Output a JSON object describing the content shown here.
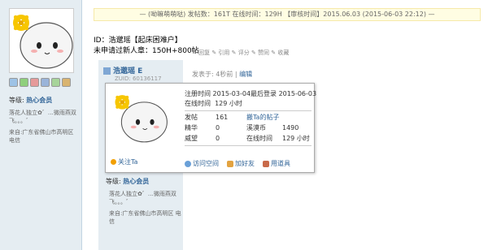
{
  "sidebar": {
    "level_prefix": "等级:",
    "level_value": "热心会员",
    "signature": "落花人独立✿゛…微雨燕双飞。。。゛",
    "location": "来自:广东省佛山市高明区 电信"
  },
  "topbar": {
    "text": "— (呦嘛萌萌哒) 发帖数：161T   在线时间：129H   【审核时间】2015.06.03 (2015-06-03 22:12) —"
  },
  "post_header": {
    "id_line": "ID：浩邈瑶【起床困难户】",
    "medal_line": "未申请过新人章：150H+800帖"
  },
  "post": {
    "username": "浩邈瑶 E",
    "uid": "ZUID: 60136117",
    "published": "发表于: 4秒前",
    "edit_link": "编辑",
    "top_actions": "✎ 回复    ✎ 引用    ✎ 评分    ✎ 赞同    ✎ 收藏"
  },
  "card": {
    "register_label": "注册时间",
    "register_value": "2015-03-04",
    "lastlogin_label": "最后登录",
    "lastlogin_value": "2015-06-03",
    "online_label": "在线时间",
    "online_value": "129 小时",
    "posts_label": "发帖",
    "posts_value": "161",
    "posts_link": "搬Ta的帖子",
    "digest_label": "精华",
    "digest_value": "0",
    "coin_label": "溪漠币",
    "coin_value": "1490",
    "prestige_label": "威望",
    "prestige_value": "0",
    "online2_label": "在线时间",
    "online2_value": "129 小时",
    "follow_label": "关注Ta",
    "visit_label": "访问空间",
    "addfriend_label": "加好友",
    "tool_label": "用道具"
  },
  "post_side2": {
    "level_prefix": "等级:",
    "level_value": "热心会员",
    "signature": "落花人独立✿゛…微雨燕双飞。。。゛",
    "location": "来自:广东省佛山市高明区 电信"
  },
  "colors": {
    "link": "#336699",
    "sidebar_bg": "#e5edf2",
    "topbar_bg": "#fffde3",
    "flower": "#f7c600"
  }
}
